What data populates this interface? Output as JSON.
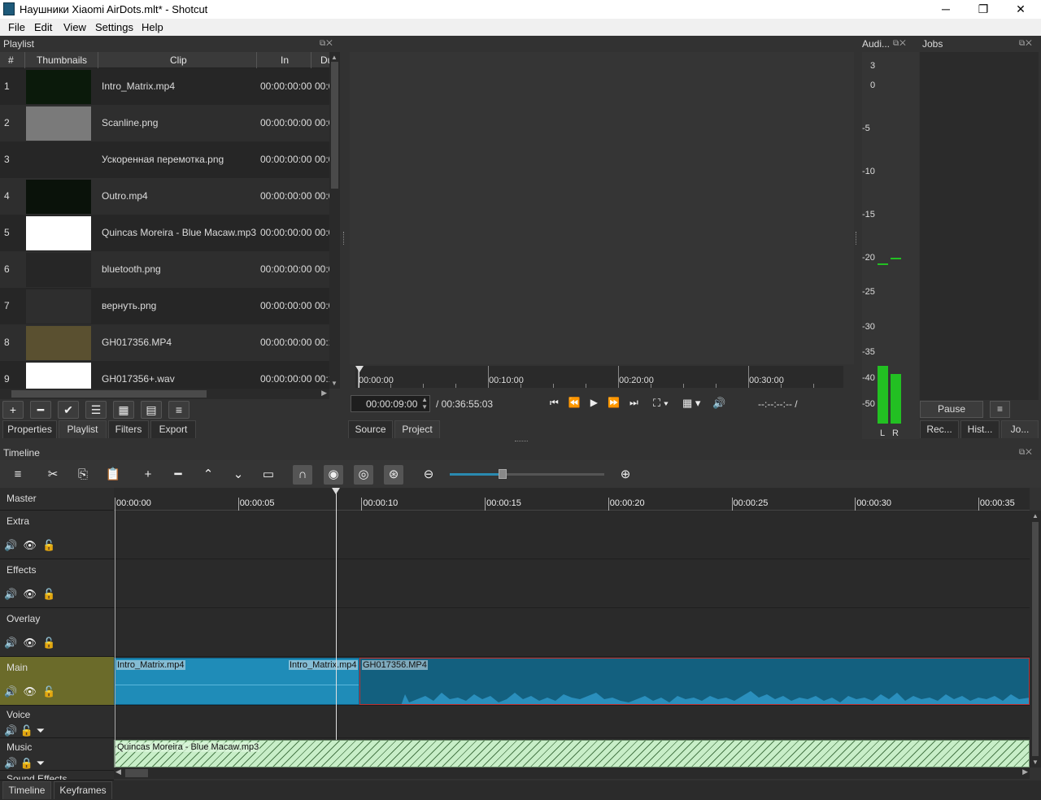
{
  "window": {
    "title": "Наушники Xiaomi AirDots.mlt* - Shotcut",
    "minimize": "─",
    "maximize": "❐",
    "close": "✕"
  },
  "menu": [
    "File",
    "Edit",
    "View",
    "Settings",
    "Help"
  ],
  "playlist": {
    "title": "Playlist",
    "columns": {
      "num": "#",
      "thumbnails": "Thumbnails",
      "clip": "Clip",
      "in": "In",
      "dur": "Du"
    },
    "rows": [
      {
        "num": "1",
        "clip": "Intro_Matrix.mp4",
        "in": "00:00:00:00",
        "dur": "00:0",
        "thumb": "#0b1a0b"
      },
      {
        "num": "2",
        "clip": "Scanline.png",
        "in": "00:00:00:00",
        "dur": "00:0",
        "thumb": "#7a7a7a"
      },
      {
        "num": "3",
        "clip": "Ускоренная перемотка.png",
        "in": "00:00:00:00",
        "dur": "00:0",
        "thumb": "#262626"
      },
      {
        "num": "4",
        "clip": "Outro.mp4",
        "in": "00:00:00:00",
        "dur": "00:0",
        "thumb": "#0a120a"
      },
      {
        "num": "5",
        "clip": "Quincas Moreira - Blue Macaw.mp3",
        "in": "00:00:00:00",
        "dur": "00:0",
        "thumb": "#ffffff"
      },
      {
        "num": "6",
        "clip": "bluetooth.png",
        "in": "00:00:00:00",
        "dur": "00:0",
        "thumb": "#262626"
      },
      {
        "num": "7",
        "clip": "вернуть.png",
        "in": "00:00:00:00",
        "dur": "00:0",
        "thumb": "#2e2e2e"
      },
      {
        "num": "8",
        "clip": "GH017356.MP4",
        "in": "00:00:00:00",
        "dur": "00:1",
        "thumb": "#5a5030"
      },
      {
        "num": "9",
        "clip": "GH017356+.wav",
        "in": "00:00:00:00",
        "dur": "00:1",
        "thumb": "#ffffff"
      }
    ],
    "toolbar_icons": [
      "add-icon",
      "remove-icon",
      "check-icon",
      "list-icon",
      "grid-icon",
      "details-icon",
      "menu-icon"
    ],
    "toolbar_glyphs": [
      "+",
      "━",
      "✔",
      "☰",
      "▦",
      "▤",
      "≡"
    ]
  },
  "left_tabs": [
    "Properties",
    "Playlist",
    "Filters",
    "Export"
  ],
  "viewer": {
    "ruler_labels": [
      "00:00:00",
      "00:10:00",
      "00:20:00",
      "00:30:00"
    ],
    "timecode": "00:00:09:00",
    "total": "/ 00:36:55:03",
    "in_out": "--:--:--:-- /",
    "tabs": [
      "Source",
      "Project"
    ],
    "transport_glyphs": [
      "⏮",
      "⏪",
      "▶",
      "⏩",
      "⏭"
    ]
  },
  "audio": {
    "title": "Audi...",
    "scale": [
      "3",
      "0",
      "-5",
      "-10",
      "-15",
      "-20",
      "-25",
      "-30",
      "-35",
      "-40",
      "-50"
    ],
    "channels": [
      "L",
      "R"
    ],
    "color": "#22c022"
  },
  "jobs": {
    "title": "Jobs",
    "pause": "Pause",
    "menu": "≡",
    "tabs": [
      "Rec...",
      "Hist...",
      "Jo..."
    ]
  },
  "timeline": {
    "title": "Timeline",
    "ruler": [
      "00:00:00",
      "00:00:05",
      "00:00:10",
      "00:00:15",
      "00:00:20",
      "00:00:25",
      "00:00:30",
      "00:00:35"
    ],
    "tracks": [
      {
        "name": "Master"
      },
      {
        "name": "Extra"
      },
      {
        "name": "Effects"
      },
      {
        "name": "Overlay"
      },
      {
        "name": "Main"
      },
      {
        "name": "Voice"
      },
      {
        "name": "Music"
      },
      {
        "name": "Sound Effects"
      }
    ],
    "clips": {
      "main_a": "Intro_Matrix.mp4",
      "main_b": "Intro_Matrix.mp4",
      "main_c": "GH017356.MP4",
      "music": "Quincas Moreira - Blue Macaw.mp3"
    },
    "zoom_fraction": 0.34,
    "tool_glyphs": [
      "≡",
      "✂",
      "⎘",
      "📋",
      "+",
      "━",
      "⌃",
      "⌄",
      "▭",
      "∩",
      "◉",
      "◎",
      "⊛"
    ],
    "tool_names": [
      "menu-icon",
      "cut-icon",
      "copy-icon",
      "paste-icon",
      "append-icon",
      "remove-icon",
      "lift-icon",
      "overwrite-icon",
      "split-icon",
      "snap-icon",
      "scrub-icon",
      "ripple-icon",
      "ripple-all-icon"
    ],
    "zoom_out": "⊖",
    "zoom_in": "⊕"
  },
  "bottom_tabs": [
    "Timeline",
    "Keyframes"
  ]
}
